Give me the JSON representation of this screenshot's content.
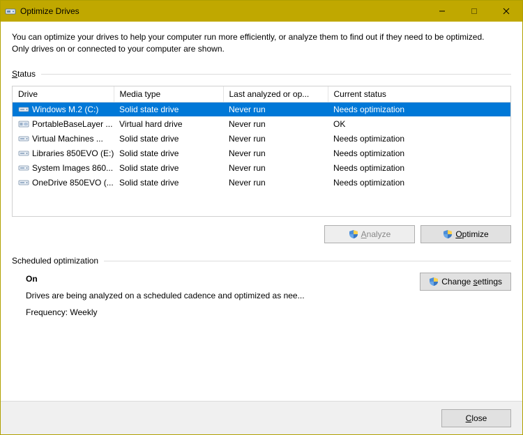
{
  "window": {
    "title": "Optimize Drives"
  },
  "description": "You can optimize your drives to help your computer run more efficiently, or analyze them to find out if they need to be optimized. Only drives on or connected to your computer are shown.",
  "status_label": "Status",
  "table": {
    "headers": {
      "drive": "Drive",
      "media": "Media type",
      "last": "Last analyzed or op...",
      "status": "Current status"
    },
    "rows": [
      {
        "drive": "Windows M.2 (C:)",
        "media": "Solid state drive",
        "last": "Never run",
        "status": "Needs optimization",
        "selected": true,
        "icon": "ssd"
      },
      {
        "drive": "PortableBaseLayer ...",
        "media": "Virtual hard drive",
        "last": "Never run",
        "status": "OK",
        "selected": false,
        "icon": "vhd"
      },
      {
        "drive": "Virtual Machines ...",
        "media": "Solid state drive",
        "last": "Never run",
        "status": "Needs optimization",
        "selected": false,
        "icon": "ssd"
      },
      {
        "drive": "Libraries 850EVO (E:)",
        "media": "Solid state drive",
        "last": "Never run",
        "status": "Needs optimization",
        "selected": false,
        "icon": "ssd"
      },
      {
        "drive": "System Images 860...",
        "media": "Solid state drive",
        "last": "Never run",
        "status": "Needs optimization",
        "selected": false,
        "icon": "ssd"
      },
      {
        "drive": "OneDrive 850EVO (...",
        "media": "Solid state drive",
        "last": "Never run",
        "status": "Needs optimization",
        "selected": false,
        "icon": "ssd"
      }
    ]
  },
  "buttons": {
    "analyze": "Analyze",
    "optimize": "Optimize",
    "change_settings": "Change settings",
    "close": "Close"
  },
  "scheduled": {
    "label": "Scheduled optimization",
    "on": "On",
    "desc": "Drives are being analyzed on a scheduled cadence and optimized as nee...",
    "freq": "Frequency: Weekly"
  }
}
